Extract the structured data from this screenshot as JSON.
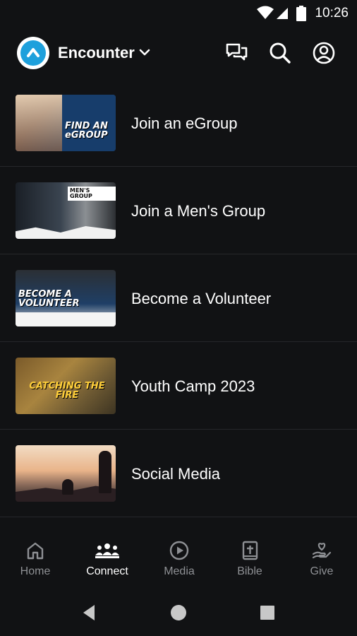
{
  "status": {
    "time": "10:26"
  },
  "header": {
    "org_name": "Encounter"
  },
  "items": [
    {
      "label": "Join an eGroup",
      "thumb_text": "FIND AN eGROUP"
    },
    {
      "label": "Join a Men's Group",
      "thumb_text": "MEN'S GROUP"
    },
    {
      "label": "Become a Volunteer",
      "thumb_text": "BECOME A VOLUNTEER"
    },
    {
      "label": "Youth Camp 2023",
      "thumb_text": "CATCHING THE FIRE"
    },
    {
      "label": "Social Media",
      "thumb_text": ""
    }
  ],
  "tabs": [
    {
      "label": "Home",
      "icon": "home-icon",
      "active": false
    },
    {
      "label": "Connect",
      "icon": "people-icon",
      "active": true
    },
    {
      "label": "Media",
      "icon": "play-icon",
      "active": false
    },
    {
      "label": "Bible",
      "icon": "bible-icon",
      "active": false
    },
    {
      "label": "Give",
      "icon": "give-icon",
      "active": false
    }
  ],
  "colors": {
    "background": "#111214",
    "accent": "#1ea0dc",
    "divider": "#26272b",
    "inactive": "#8e9094"
  }
}
